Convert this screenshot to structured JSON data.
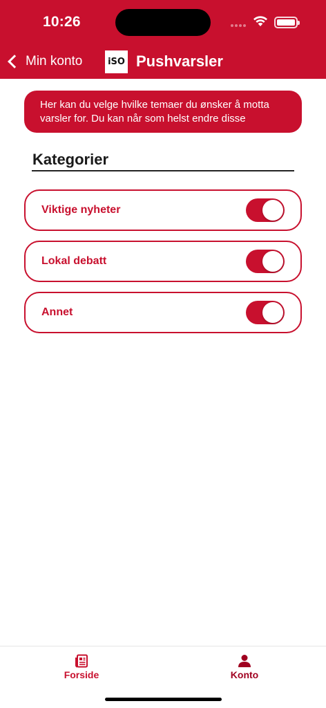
{
  "status_bar": {
    "time": "10:26"
  },
  "nav": {
    "back_label": "Min konto",
    "logo_text": "iSO",
    "title": "Pushvarsler"
  },
  "info_banner": {
    "text": "Her kan du velge hvilke temaer du ønsker å motta varsler for. Du kan når som helst endre disse"
  },
  "section": {
    "heading": "Kategorier"
  },
  "categories": [
    {
      "label": "Viktige nyheter",
      "enabled": true
    },
    {
      "label": "Lokal debatt",
      "enabled": true
    },
    {
      "label": "Annet",
      "enabled": true
    }
  ],
  "tab_bar": {
    "tabs": [
      {
        "label": "Forside",
        "icon": "newspaper-icon",
        "color": "#c8102e"
      },
      {
        "label": "Konto",
        "icon": "person-icon",
        "color": "#a00020"
      }
    ]
  },
  "colors": {
    "brand": "#c8102e",
    "background": "#ffffff",
    "heading": "#1a1a1a"
  }
}
